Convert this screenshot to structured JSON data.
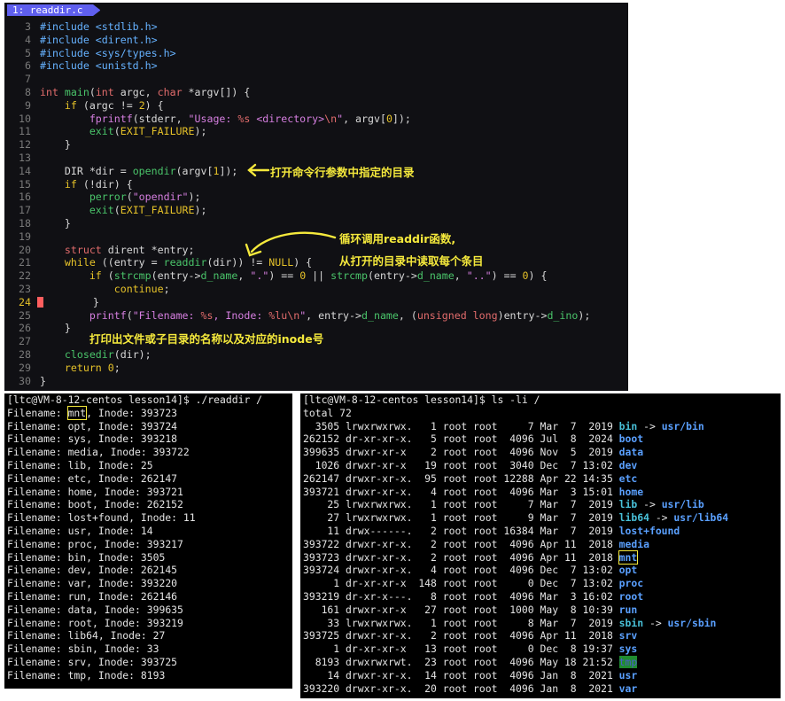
{
  "editor": {
    "tab_label": "1: readdir.c",
    "lines": [
      {
        "n": "3",
        "segs": [
          [
            "t-pp",
            "#include <stdlib.h>"
          ]
        ]
      },
      {
        "n": "4",
        "segs": [
          [
            "t-pp",
            "#include <dirent.h>"
          ]
        ]
      },
      {
        "n": "5",
        "segs": [
          [
            "t-pp",
            "#include <sys/types.h>"
          ]
        ]
      },
      {
        "n": "6",
        "segs": [
          [
            "t-pp",
            "#include <unistd.h>"
          ]
        ]
      },
      {
        "n": "7",
        "segs": []
      },
      {
        "n": "8",
        "segs": [
          [
            "t-ty",
            "int "
          ],
          [
            "t-fn",
            "main"
          ],
          [
            "t-nm",
            "("
          ],
          [
            "t-ty",
            "int"
          ],
          [
            "t-nm",
            " argc, "
          ],
          [
            "t-ty",
            "char"
          ],
          [
            "t-nm",
            " *argv[]) {"
          ]
        ]
      },
      {
        "n": "9",
        "segs": [
          [
            "t-nm",
            "    "
          ],
          [
            "t-kw",
            "if"
          ],
          [
            "t-nm",
            " (argc != "
          ],
          [
            "t-num",
            "2"
          ],
          [
            "t-nm",
            ") {"
          ]
        ]
      },
      {
        "n": "10",
        "segs": [
          [
            "t-nm",
            "        "
          ],
          [
            "t-fp",
            "fprintf"
          ],
          [
            "t-nm",
            "(stderr, "
          ],
          [
            "t-st",
            "\"Usage: "
          ],
          [
            "t-esc",
            "%s"
          ],
          [
            "t-st",
            " <directory>"
          ],
          [
            "t-esc",
            "\\n"
          ],
          [
            "t-st",
            "\""
          ],
          [
            "t-nm",
            ", argv["
          ],
          [
            "t-num",
            "0"
          ],
          [
            "t-nm",
            "]);"
          ]
        ]
      },
      {
        "n": "11",
        "segs": [
          [
            "t-nm",
            "        "
          ],
          [
            "t-fn",
            "exit"
          ],
          [
            "t-nm",
            "("
          ],
          [
            "t-mc",
            "EXIT_FAILURE"
          ],
          [
            "t-nm",
            ");"
          ]
        ]
      },
      {
        "n": "12",
        "segs": [
          [
            "t-nm",
            "    }"
          ]
        ]
      },
      {
        "n": "13",
        "segs": []
      },
      {
        "n": "14",
        "segs": [
          [
            "t-nm",
            "    DIR *dir = "
          ],
          [
            "t-fn",
            "opendir"
          ],
          [
            "t-nm",
            "(argv["
          ],
          [
            "t-num",
            "1"
          ],
          [
            "t-nm",
            "]);"
          ]
        ]
      },
      {
        "n": "15",
        "segs": [
          [
            "t-nm",
            "    "
          ],
          [
            "t-kw",
            "if"
          ],
          [
            "t-nm",
            " (!dir) {"
          ]
        ]
      },
      {
        "n": "16",
        "segs": [
          [
            "t-nm",
            "        "
          ],
          [
            "t-fn",
            "perror"
          ],
          [
            "t-nm",
            "("
          ],
          [
            "t-st",
            "\"opendir\""
          ],
          [
            "t-nm",
            ");"
          ]
        ]
      },
      {
        "n": "17",
        "segs": [
          [
            "t-nm",
            "        "
          ],
          [
            "t-fn",
            "exit"
          ],
          [
            "t-nm",
            "("
          ],
          [
            "t-mc",
            "EXIT_FAILURE"
          ],
          [
            "t-nm",
            ");"
          ]
        ]
      },
      {
        "n": "18",
        "segs": [
          [
            "t-nm",
            "    }"
          ]
        ]
      },
      {
        "n": "19",
        "segs": []
      },
      {
        "n": "20",
        "segs": [
          [
            "t-nm",
            "    "
          ],
          [
            "t-ty",
            "struct"
          ],
          [
            "t-nm",
            " dirent *entry;"
          ]
        ]
      },
      {
        "n": "21",
        "segs": [
          [
            "t-nm",
            "    "
          ],
          [
            "t-kw",
            "while"
          ],
          [
            "t-nm",
            " ((entry = "
          ],
          [
            "t-fn",
            "readdir"
          ],
          [
            "t-nm",
            "(dir)) != "
          ],
          [
            "t-mc",
            "NULL"
          ],
          [
            "t-nm",
            ") {"
          ]
        ]
      },
      {
        "n": "22",
        "segs": [
          [
            "t-nm",
            "        "
          ],
          [
            "t-kw",
            "if"
          ],
          [
            "t-nm",
            " ("
          ],
          [
            "t-fn",
            "strcmp"
          ],
          [
            "t-nm",
            "(entry->"
          ],
          [
            "t-fld",
            "d_name"
          ],
          [
            "t-nm",
            ", "
          ],
          [
            "t-st",
            "\".\""
          ],
          [
            "t-nm",
            ") == "
          ],
          [
            "t-num",
            "0"
          ],
          [
            "t-nm",
            " || "
          ],
          [
            "t-fn",
            "strcmp"
          ],
          [
            "t-nm",
            "(entry->"
          ],
          [
            "t-fld",
            "d_name"
          ],
          [
            "t-nm",
            ", "
          ],
          [
            "t-st",
            "\"..\""
          ],
          [
            "t-nm",
            ") == "
          ],
          [
            "t-num",
            "0"
          ],
          [
            "t-nm",
            ") {"
          ]
        ]
      },
      {
        "n": "23",
        "segs": [
          [
            "t-nm",
            "            "
          ],
          [
            "t-kw",
            "continue"
          ],
          [
            "t-nm",
            ";"
          ]
        ]
      },
      {
        "n": "24",
        "cur": true,
        "segs": [
          [
            "t-nm",
            "        }"
          ]
        ]
      },
      {
        "n": "25",
        "segs": [
          [
            "t-nm",
            "        "
          ],
          [
            "t-fp",
            "printf"
          ],
          [
            "t-nm",
            "("
          ],
          [
            "t-st",
            "\"Filename: "
          ],
          [
            "t-esc",
            "%s"
          ],
          [
            "t-st",
            ", Inode: "
          ],
          [
            "t-esc",
            "%lu\\n"
          ],
          [
            "t-st",
            "\""
          ],
          [
            "t-nm",
            ", entry->"
          ],
          [
            "t-fld",
            "d_name"
          ],
          [
            "t-nm",
            ", ("
          ],
          [
            "t-ty",
            "unsigned long"
          ],
          [
            "t-nm",
            ")entry->"
          ],
          [
            "t-fld",
            "d_ino"
          ],
          [
            "t-nm",
            ");"
          ]
        ]
      },
      {
        "n": "26",
        "segs": [
          [
            "t-nm",
            "    }"
          ]
        ]
      },
      {
        "n": "27",
        "segs": []
      },
      {
        "n": "28",
        "segs": [
          [
            "t-nm",
            "    "
          ],
          [
            "t-fn",
            "closedir"
          ],
          [
            "t-nm",
            "(dir);"
          ]
        ]
      },
      {
        "n": "29",
        "segs": [
          [
            "t-nm",
            "    "
          ],
          [
            "t-kw",
            "return"
          ],
          [
            "t-nm",
            " "
          ],
          [
            "t-num",
            "0"
          ],
          [
            "t-nm",
            ";"
          ]
        ]
      },
      {
        "n": "30",
        "segs": [
          [
            "t-nm",
            "}"
          ]
        ]
      }
    ],
    "annotations": {
      "opendir_note": "打开命令行参数中指定的目录",
      "readdir_note_1": "循环调用readdir函数,",
      "readdir_note_2": "从打开的目录中读取每个条目",
      "printf_note": "打印出文件或子目录的名称以及对应的inode号"
    },
    "annotation_color": "#f5e93c"
  },
  "terminal_left": {
    "prompt": "[ltc@VM-8-12-centos lesson14]$ ./readdir /",
    "rows": [
      {
        "name": "mnt",
        "inode": "393723",
        "highlight": true
      },
      {
        "name": "opt",
        "inode": "393724"
      },
      {
        "name": "sys",
        "inode": "393218"
      },
      {
        "name": "media",
        "inode": "393722"
      },
      {
        "name": "lib",
        "inode": "25"
      },
      {
        "name": "etc",
        "inode": "262147"
      },
      {
        "name": "home",
        "inode": "393721"
      },
      {
        "name": "boot",
        "inode": "262152"
      },
      {
        "name": "lost+found",
        "inode": "11"
      },
      {
        "name": "usr",
        "inode": "14"
      },
      {
        "name": "proc",
        "inode": "393217"
      },
      {
        "name": "bin",
        "inode": "3505"
      },
      {
        "name": "dev",
        "inode": "262145"
      },
      {
        "name": "var",
        "inode": "393220"
      },
      {
        "name": "run",
        "inode": "262146"
      },
      {
        "name": "data",
        "inode": "399635"
      },
      {
        "name": "root",
        "inode": "393219"
      },
      {
        "name": "lib64",
        "inode": "27"
      },
      {
        "name": "sbin",
        "inode": "33"
      },
      {
        "name": "srv",
        "inode": "393725"
      },
      {
        "name": "tmp",
        "inode": "8193"
      }
    ]
  },
  "terminal_right": {
    "prompt": "[ltc@VM-8-12-centos lesson14]$ ls -li /",
    "total": "total 72",
    "rows": [
      {
        "inode": "3505",
        "perm": "lrwxrwxrwx.",
        "links": "1",
        "owner": "root",
        "group": "root",
        "size": "7",
        "mon": "Mar",
        "day": "7",
        "time": "2019",
        "name": "bin",
        "kind": "link",
        "target": "usr/bin"
      },
      {
        "inode": "262152",
        "perm": "dr-xr-xr-x.",
        "links": "5",
        "owner": "root",
        "group": "root",
        "size": "4096",
        "mon": "Jul",
        "day": "8",
        "time": "2024",
        "name": "boot",
        "kind": "dir"
      },
      {
        "inode": "399635",
        "perm": "drwxr-xr-x",
        "links": "2",
        "owner": "root",
        "group": "root",
        "size": "4096",
        "mon": "Nov",
        "day": "5",
        "time": "2019",
        "name": "data",
        "kind": "dir"
      },
      {
        "inode": "1026",
        "perm": "drwxr-xr-x",
        "links": "19",
        "owner": "root",
        "group": "root",
        "size": "3040",
        "mon": "Dec",
        "day": "7",
        "time": "13:02",
        "name": "dev",
        "kind": "dir"
      },
      {
        "inode": "262147",
        "perm": "drwxr-xr-x.",
        "links": "95",
        "owner": "root",
        "group": "root",
        "size": "12288",
        "mon": "Apr",
        "day": "22",
        "time": "14:35",
        "name": "etc",
        "kind": "dir"
      },
      {
        "inode": "393721",
        "perm": "drwxr-xr-x.",
        "links": "4",
        "owner": "root",
        "group": "root",
        "size": "4096",
        "mon": "Mar",
        "day": "3",
        "time": "15:01",
        "name": "home",
        "kind": "dir"
      },
      {
        "inode": "25",
        "perm": "lrwxrwxrwx.",
        "links": "1",
        "owner": "root",
        "group": "root",
        "size": "7",
        "mon": "Mar",
        "day": "7",
        "time": "2019",
        "name": "lib",
        "kind": "link",
        "target": "usr/lib"
      },
      {
        "inode": "27",
        "perm": "lrwxrwxrwx.",
        "links": "1",
        "owner": "root",
        "group": "root",
        "size": "9",
        "mon": "Mar",
        "day": "7",
        "time": "2019",
        "name": "lib64",
        "kind": "link",
        "target": "usr/lib64"
      },
      {
        "inode": "11",
        "perm": "drwx------.",
        "links": "2",
        "owner": "root",
        "group": "root",
        "size": "16384",
        "mon": "Mar",
        "day": "7",
        "time": "2019",
        "name": "lost+found",
        "kind": "dir"
      },
      {
        "inode": "393722",
        "perm": "drwxr-xr-x.",
        "links": "2",
        "owner": "root",
        "group": "root",
        "size": "4096",
        "mon": "Apr",
        "day": "11",
        "time": "2018",
        "name": "media",
        "kind": "dir"
      },
      {
        "inode": "393723",
        "perm": "drwxr-xr-x.",
        "links": "2",
        "owner": "root",
        "group": "root",
        "size": "4096",
        "mon": "Apr",
        "day": "11",
        "time": "2018",
        "name": "mnt",
        "kind": "dir",
        "highlight": true
      },
      {
        "inode": "393724",
        "perm": "drwxr-xr-x.",
        "links": "4",
        "owner": "root",
        "group": "root",
        "size": "4096",
        "mon": "Dec",
        "day": "7",
        "time": "13:02",
        "name": "opt",
        "kind": "dir"
      },
      {
        "inode": "1",
        "perm": "dr-xr-xr-x",
        "links": "148",
        "owner": "root",
        "group": "root",
        "size": "0",
        "mon": "Dec",
        "day": "7",
        "time": "13:02",
        "name": "proc",
        "kind": "dir"
      },
      {
        "inode": "393219",
        "perm": "dr-xr-x---.",
        "links": "8",
        "owner": "root",
        "group": "root",
        "size": "4096",
        "mon": "Mar",
        "day": "3",
        "time": "16:02",
        "name": "root",
        "kind": "dir"
      },
      {
        "inode": "161",
        "perm": "drwxr-xr-x",
        "links": "27",
        "owner": "root",
        "group": "root",
        "size": "1000",
        "mon": "May",
        "day": "8",
        "time": "10:39",
        "name": "run",
        "kind": "dir"
      },
      {
        "inode": "33",
        "perm": "lrwxrwxrwx.",
        "links": "1",
        "owner": "root",
        "group": "root",
        "size": "8",
        "mon": "Mar",
        "day": "7",
        "time": "2019",
        "name": "sbin",
        "kind": "link",
        "target": "usr/sbin"
      },
      {
        "inode": "393725",
        "perm": "drwxr-xr-x.",
        "links": "2",
        "owner": "root",
        "group": "root",
        "size": "4096",
        "mon": "Apr",
        "day": "11",
        "time": "2018",
        "name": "srv",
        "kind": "dir"
      },
      {
        "inode": "1",
        "perm": "dr-xr-xr-x",
        "links": "13",
        "owner": "root",
        "group": "root",
        "size": "0",
        "mon": "Dec",
        "day": "8",
        "time": "19:37",
        "name": "sys",
        "kind": "dir"
      },
      {
        "inode": "8193",
        "perm": "drwxrwxrwt.",
        "links": "23",
        "owner": "root",
        "group": "root",
        "size": "4096",
        "mon": "May",
        "day": "18",
        "time": "21:52",
        "name": "tmp",
        "kind": "tmp"
      },
      {
        "inode": "14",
        "perm": "drwxr-xr-x.",
        "links": "14",
        "owner": "root",
        "group": "root",
        "size": "4096",
        "mon": "Jan",
        "day": "8",
        "time": "2021",
        "name": "usr",
        "kind": "dir"
      },
      {
        "inode": "393220",
        "perm": "drwxr-xr-x.",
        "links": "20",
        "owner": "root",
        "group": "root",
        "size": "4096",
        "mon": "Jan",
        "day": "8",
        "time": "2021",
        "name": "var",
        "kind": "dir"
      }
    ]
  }
}
